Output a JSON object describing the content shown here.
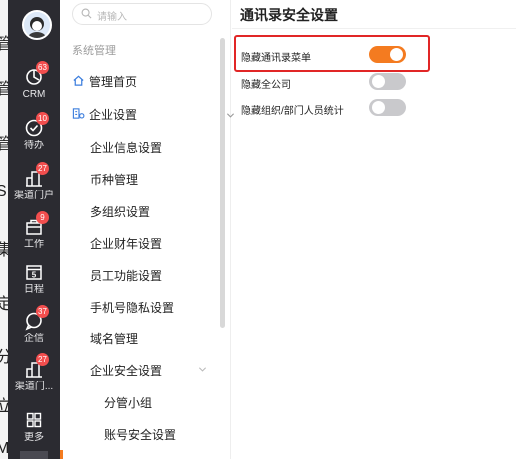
{
  "background_glyphs": [
    "管",
    "管",
    "管",
    "S",
    "集",
    "定",
    "分",
    "立",
    "M"
  ],
  "rail": {
    "items": [
      {
        "id": "crm",
        "label": "CRM",
        "badge": "63"
      },
      {
        "id": "todo",
        "label": "待办",
        "badge": "10"
      },
      {
        "id": "channel",
        "label": "渠道门户",
        "badge": "27"
      },
      {
        "id": "work",
        "label": "工作",
        "badge": "9"
      },
      {
        "id": "schedule",
        "label": "日程",
        "badge": "",
        "icon_text": "5"
      },
      {
        "id": "enterprise-chat",
        "label": "企信",
        "badge": "37"
      },
      {
        "id": "channel2",
        "label": "渠道门...",
        "badge": "27"
      },
      {
        "id": "more",
        "label": "更多",
        "badge": ""
      }
    ]
  },
  "menu": {
    "search_placeholder": "请输入",
    "group_title": "系统管理",
    "home": "管理首页",
    "enterprise_settings": "企业设置",
    "children": [
      "企业信息设置",
      "币种管理",
      "多组织设置",
      "企业财年设置",
      "员工功能设置",
      "手机号隐私设置",
      "域名管理"
    ],
    "security_settings": "企业安全设置",
    "security_children": [
      "分管小组",
      "账号安全设置"
    ]
  },
  "panel": {
    "title": "通讯录安全设置",
    "rows": [
      {
        "label": "隐藏通讯录菜单",
        "on": true
      },
      {
        "label": "隐藏全公司",
        "on": false
      },
      {
        "label": "隐藏组织/部门人员统计",
        "on": false
      }
    ]
  },
  "colors": {
    "accent": "#f47b20",
    "rail_bg": "#2b2b31",
    "badge": "#f24e4e",
    "highlight": "#e12626"
  }
}
